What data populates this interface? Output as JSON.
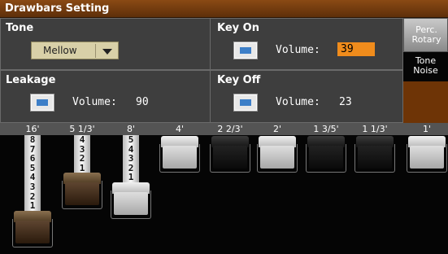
{
  "title": "Drawbars Setting",
  "tone": {
    "label": "Tone",
    "selected": "Mellow"
  },
  "key_on": {
    "label": "Key On",
    "volume_label": "Volume:",
    "volume": "39"
  },
  "leakage": {
    "label": "Leakage",
    "volume_label": "Volume:",
    "volume": "90"
  },
  "key_off": {
    "label": "Key Off",
    "volume_label": "Volume:",
    "volume": "23"
  },
  "tabs": [
    {
      "label": "Perc.\nRotary"
    },
    {
      "label": "Tone\nNoise"
    }
  ],
  "drawbar_footages": [
    "16'",
    "5 1/3'",
    "8'",
    "4'",
    "2 2/3'",
    "2'",
    "1 3/5'",
    "1 1/3'",
    "1'"
  ],
  "drawbar_levels": [
    8,
    4,
    5,
    0,
    0,
    0,
    0,
    0,
    0
  ],
  "colors": {
    "accent": "#f08c1c",
    "title_bar": "#7a3f10",
    "checkbox": "#3d7fc8"
  }
}
